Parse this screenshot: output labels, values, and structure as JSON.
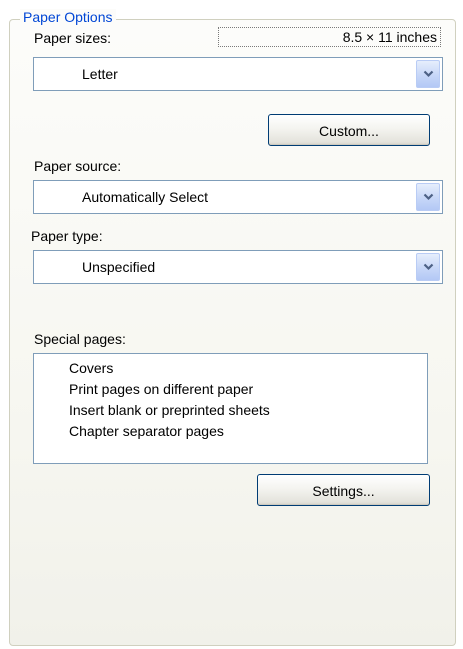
{
  "group": {
    "title": "Paper Options"
  },
  "paper_sizes": {
    "label": "Paper sizes:",
    "dimensions": "8.5 × 11 inches",
    "selected": "Letter",
    "custom_button": "Custom..."
  },
  "paper_source": {
    "label": "Paper source:",
    "selected": "Automatically Select"
  },
  "paper_type": {
    "label": "Paper type:",
    "selected": "Unspecified"
  },
  "special_pages": {
    "label": "Special pages:",
    "items": [
      "Covers",
      "Print pages on different paper",
      "Insert blank or preprinted sheets",
      "Chapter separator pages"
    ],
    "settings_button": "Settings..."
  },
  "icons": {
    "dropdown_arrow": "chevron-down-icon"
  },
  "colors": {
    "group_title": "#0046d5",
    "field_border": "#7f9db9",
    "button_border": "#003c74"
  }
}
